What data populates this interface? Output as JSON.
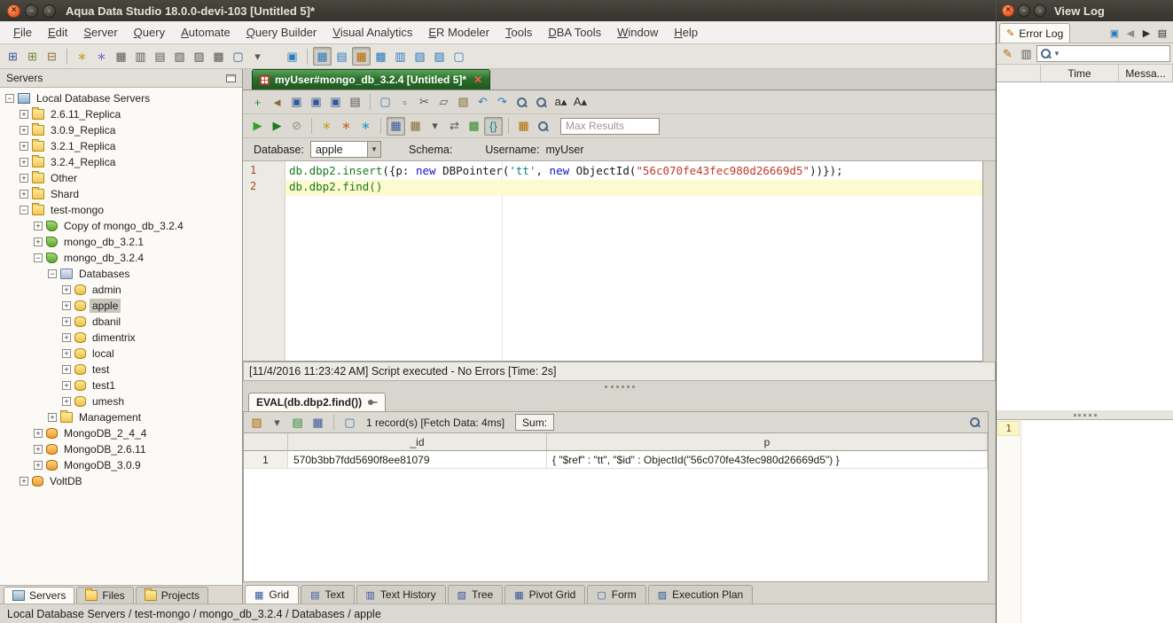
{
  "window": {
    "title": "Aqua Data Studio 18.0.0-devi-103 [Untitled 5]*"
  },
  "menu": {
    "items": [
      "File",
      "Edit",
      "Server",
      "Query",
      "Automate",
      "Query Builder",
      "Visual Analytics",
      "ER Modeler",
      "Tools",
      "DBA Tools",
      "Window",
      "Help"
    ]
  },
  "main_toolbar": {
    "group1": [
      {
        "name": "register-server-icon",
        "glyph": "⊞",
        "color": "#35589a"
      },
      {
        "name": "discover-servers-icon",
        "glyph": "⊞",
        "color": "#6a8a35"
      },
      {
        "name": "connection-manager-icon",
        "glyph": "⊟",
        "color": "#8a6d3b"
      },
      {
        "sep": true
      },
      {
        "name": "schema-compare-wand-icon",
        "glyph": "∗",
        "color": "#c9a227"
      },
      {
        "name": "script-wand-icon",
        "glyph": "∗",
        "color": "#8a6dc9"
      },
      {
        "name": "find-tables-icon",
        "glyph": "▦",
        "color": "#5a5750"
      },
      {
        "name": "find-views-icon",
        "glyph": "▥",
        "color": "#5a5750"
      },
      {
        "name": "find-procedures-icon",
        "glyph": "▤",
        "color": "#5a5750"
      },
      {
        "name": "find-columns-icon",
        "glyph": "▧",
        "color": "#5a5750"
      },
      {
        "name": "find-indexes-icon",
        "glyph": "▨",
        "color": "#5a5750"
      },
      {
        "name": "find-scripts-icon",
        "glyph": "▩",
        "color": "#5a5750"
      },
      {
        "name": "open-document-icon",
        "glyph": "▢",
        "color": "#35589a"
      },
      {
        "name": "open-document-dropdown-icon",
        "glyph": "▾",
        "color": "#5a5750"
      }
    ],
    "group2": [
      {
        "name": "query-analyzer-icon",
        "glyph": "▣",
        "color": "#2b7bbd"
      },
      {
        "sep": true
      },
      {
        "name": "results-grid-mode-icon",
        "glyph": "▦",
        "color": "#2b7bbd",
        "pressed": true
      },
      {
        "name": "results-text-mode-icon",
        "glyph": "▤",
        "color": "#2b7bbd"
      },
      {
        "name": "pin-results-icon",
        "glyph": "▦",
        "color": "#b26a00",
        "pressed": true
      },
      {
        "name": "multi-grid-icon",
        "glyph": "▩",
        "color": "#2b7bbd"
      },
      {
        "name": "history-grid-icon",
        "glyph": "▥",
        "color": "#2b7bbd"
      },
      {
        "name": "tree-window-icon",
        "glyph": "▧",
        "color": "#2b7bbd"
      },
      {
        "name": "pivot-window-icon",
        "glyph": "▨",
        "color": "#2b7bbd"
      },
      {
        "name": "form-window-icon",
        "glyph": "▢",
        "color": "#2b7bbd"
      }
    ]
  },
  "servers_panel": {
    "title": "Servers",
    "tree": [
      {
        "label": "Local Database Servers",
        "level": 0,
        "toggle": "minus",
        "icon": "computer"
      },
      {
        "label": "2.6.11_Replica",
        "level": 1,
        "toggle": "plus",
        "icon": "folder"
      },
      {
        "label": "3.0.9_Replica",
        "level": 1,
        "toggle": "plus",
        "icon": "folder"
      },
      {
        "label": "3.2.1_Replica",
        "level": 1,
        "toggle": "plus",
        "icon": "folder"
      },
      {
        "label": "3.2.4_Replica",
        "level": 1,
        "toggle": "plus",
        "icon": "folder"
      },
      {
        "label": "Other",
        "level": 1,
        "toggle": "plus",
        "icon": "folder"
      },
      {
        "label": "Shard",
        "level": 1,
        "toggle": "plus",
        "icon": "folder"
      },
      {
        "label": "test-mongo",
        "level": 1,
        "toggle": "minus",
        "icon": "folder"
      },
      {
        "label": "Copy of mongo_db_3.2.4",
        "level": 2,
        "toggle": "plus",
        "icon": "mongo"
      },
      {
        "label": "mongo_db_3.2.1",
        "level": 2,
        "toggle": "plus",
        "icon": "mongo"
      },
      {
        "label": "mongo_db_3.2.4",
        "level": 2,
        "toggle": "minus",
        "icon": "mongo"
      },
      {
        "label": "Databases",
        "level": 3,
        "toggle": "minus",
        "icon": "dbfolder"
      },
      {
        "label": "admin",
        "level": 4,
        "toggle": "plus",
        "icon": "db"
      },
      {
        "label": "apple",
        "level": 4,
        "toggle": "plus",
        "icon": "db",
        "selected": true
      },
      {
        "label": "dbanil",
        "level": 4,
        "toggle": "plus",
        "icon": "db"
      },
      {
        "label": "dimentrix",
        "level": 4,
        "toggle": "plus",
        "icon": "db"
      },
      {
        "label": "local",
        "level": 4,
        "toggle": "plus",
        "icon": "db"
      },
      {
        "label": "test",
        "level": 4,
        "toggle": "plus",
        "icon": "db"
      },
      {
        "label": "test1",
        "level": 4,
        "toggle": "plus",
        "icon": "db"
      },
      {
        "label": "umesh",
        "level": 4,
        "toggle": "plus",
        "icon": "db"
      },
      {
        "label": "Management",
        "level": 3,
        "toggle": "plus",
        "icon": "folder"
      },
      {
        "label": "MongoDB_2_4_4",
        "level": 2,
        "toggle": "plus",
        "icon": "dbserver"
      },
      {
        "label": "MongoDB_2.6.11",
        "level": 2,
        "toggle": "plus",
        "icon": "dbserver"
      },
      {
        "label": "MongoDB_3.0.9",
        "level": 2,
        "toggle": "plus",
        "icon": "dbserver"
      },
      {
        "label": "VoltDB",
        "level": 1,
        "toggle": "plus",
        "icon": "dbserver"
      }
    ],
    "tabs": [
      {
        "label": "Servers",
        "icon": "computer",
        "active": true
      },
      {
        "label": "Files",
        "icon": "folder",
        "active": false
      },
      {
        "label": "Projects",
        "icon": "folder",
        "active": false
      }
    ]
  },
  "document": {
    "tab_label": "myUser#mongo_db_3.2.4 [Untitled 5]*",
    "max_results_placeholder": "Max Results",
    "toolbar_row1": [
      {
        "name": "new-file-icon",
        "glyph": "+",
        "color": "#2e8b2e"
      },
      {
        "name": "open-file-icon",
        "glyph": "◄",
        "color": "#8a6d3b"
      },
      {
        "name": "save-file-icon",
        "glyph": "▣",
        "color": "#35589a"
      },
      {
        "name": "save-all-icon",
        "glyph": "▣",
        "color": "#35589a"
      },
      {
        "name": "save-as-icon",
        "glyph": "▣",
        "color": "#35589a"
      },
      {
        "name": "print-icon",
        "glyph": "▤",
        "color": "#5a5750"
      },
      {
        "sep": true
      },
      {
        "name": "describe-object-icon",
        "glyph": "▢",
        "color": "#2b7bbd"
      },
      {
        "name": "select-block-icon",
        "glyph": "▫",
        "color": "#5a5750"
      },
      {
        "name": "cut-icon",
        "glyph": "✂",
        "color": "#5a5750"
      },
      {
        "name": "copy-icon",
        "glyph": "▱",
        "color": "#5a5750"
      },
      {
        "name": "paste-icon",
        "glyph": "▨",
        "color": "#8a6d3b"
      },
      {
        "name": "undo-icon",
        "glyph": "↶",
        "color": "#2b7bbd"
      },
      {
        "name": "redo-icon",
        "glyph": "↷",
        "color": "#2b7bbd"
      },
      {
        "name": "find-icon",
        "glyph": "mag"
      },
      {
        "name": "find-next-icon",
        "glyph": "mag"
      },
      {
        "name": "font-decrease-icon",
        "glyph": "a▴",
        "color": "#2f2d29"
      },
      {
        "name": "font-increase-icon",
        "glyph": "A▴",
        "color": "#2f2d29"
      }
    ],
    "toolbar_row2": [
      {
        "name": "execute-icon",
        "glyph": "▶",
        "color": "#2fa12f"
      },
      {
        "name": "execute-edit-icon",
        "glyph": "▶",
        "color": "#217821"
      },
      {
        "name": "cancel-execution-icon",
        "glyph": "⊘",
        "color": "#8f8c84"
      },
      {
        "sep": true
      },
      {
        "name": "format-sql-wand-icon",
        "glyph": "∗",
        "color": "#c9a227"
      },
      {
        "name": "convert-case-wand-icon",
        "glyph": "∗",
        "color": "#c96a27"
      },
      {
        "name": "snippet-wand-icon",
        "glyph": "∗",
        "color": "#27a0c9"
      },
      {
        "sep": true
      },
      {
        "name": "grid-results-icon",
        "glyph": "▦",
        "color": "#35589a",
        "pressed": true
      },
      {
        "name": "edit-grid-icon",
        "glyph": "▦",
        "color": "#8a6d3b"
      },
      {
        "name": "grid-options-dropdown-icon",
        "glyph": "▾",
        "color": "#5a5750"
      },
      {
        "name": "swap-results-icon",
        "glyph": "⇄",
        "color": "#5a5750"
      },
      {
        "name": "excel-grid-icon",
        "glyph": "▩",
        "color": "#2e8b2e"
      },
      {
        "name": "json-format-icon",
        "glyph": "{}",
        "color": "#0f7f7f",
        "pressed": true
      },
      {
        "sep": true
      },
      {
        "name": "pin-grid-icon",
        "glyph": "▦",
        "color": "#b26a00"
      },
      {
        "name": "grid-search-icon",
        "glyph": "mag"
      }
    ],
    "context": {
      "database_label": "Database:",
      "database_value": "apple",
      "schema_label": "Schema:",
      "username_label": "Username:",
      "username_value": "myUser"
    },
    "editor": {
      "lines": [
        {
          "num": "1",
          "current": false,
          "segments": [
            {
              "text": "db.dbp2.insert",
              "color": "#1a7a1a"
            },
            {
              "text": "({p: ",
              "color": "#1c1c1c"
            },
            {
              "text": "new",
              "color": "#1414cc"
            },
            {
              "text": " DBPointer(",
              "color": "#1c1c1c"
            },
            {
              "text": "'tt'",
              "color": "#0f7f7f"
            },
            {
              "text": ", ",
              "color": "#1c1c1c"
            },
            {
              "text": "new",
              "color": "#1414cc"
            },
            {
              "text": " ObjectId(",
              "color": "#1c1c1c"
            },
            {
              "text": "\"56c070fe43fec980d26669d5\"",
              "color": "#c0392b"
            },
            {
              "text": "))});",
              "color": "#1c1c1c"
            }
          ]
        },
        {
          "num": "2",
          "current": true,
          "segments": [
            {
              "text": "db.dbp2.find()",
              "color": "#1a7a1a"
            }
          ]
        }
      ]
    },
    "execution_message": "[11/4/2016 11:23:42 AM] Script executed - No Errors [Time: 2s]"
  },
  "results": {
    "tab_label": "EVAL(db.dbp2.find())",
    "toolbar_icons": [
      {
        "name": "visual-analytics-icon",
        "glyph": "▧",
        "color": "#b26a00"
      },
      {
        "name": "chart-dropdown-icon",
        "glyph": "▾",
        "color": "#5a5750"
      },
      {
        "name": "export-grid-icon",
        "glyph": "▤",
        "color": "#2e8b2e"
      },
      {
        "name": "save-grid-icon",
        "glyph": "▦",
        "color": "#35589a"
      },
      {
        "sep": true
      },
      {
        "name": "script-grid-icon",
        "glyph": "▢",
        "color": "#2b7bbd"
      }
    ],
    "record_info": "1 record(s) [Fetch Data: 4ms]",
    "sum_label": "Sum:",
    "grid": {
      "columns": [
        "_id",
        "p"
      ],
      "rows": [
        {
          "num": "1",
          "cells": [
            "570b3bb7fdd5690f8ee81079",
            "{ \"$ref\" : \"tt\", \"$id\" : ObjectId(\"56c070fe43fec980d26669d5\") }"
          ]
        }
      ]
    },
    "tabs": [
      {
        "label": "Grid",
        "glyph": "▦",
        "active": true
      },
      {
        "label": "Text",
        "glyph": "▤",
        "active": false
      },
      {
        "label": "Text History",
        "glyph": "▥",
        "active": false
      },
      {
        "label": "Tree",
        "glyph": "▧",
        "active": false
      },
      {
        "label": "Pivot Grid",
        "glyph": "▦",
        "active": false
      },
      {
        "label": "Form",
        "glyph": "▢",
        "active": false
      },
      {
        "label": "Execution Plan",
        "glyph": "▨",
        "active": false
      }
    ]
  },
  "status_bar": {
    "path": "Local Database Servers / test-mongo / mongo_db_3.2.4 / Databases / apple"
  },
  "view_log": {
    "title": "View Log",
    "tab_label": "Error Log",
    "tab_icons": [
      {
        "name": "viewlog-window-icon",
        "glyph": "▣",
        "color": "#2b7bbd"
      },
      {
        "name": "previous-log-icon",
        "glyph": "◀",
        "color": "#8f8c84"
      },
      {
        "name": "next-log-icon",
        "glyph": "▶",
        "color": "#2f2d29"
      },
      {
        "name": "log-options-icon",
        "glyph": "▤",
        "color": "#2f2d29"
      }
    ],
    "toolbar_icons": [
      {
        "name": "clear-log-icon",
        "glyph": "✎",
        "color": "#b26a00"
      },
      {
        "name": "copy-log-icon",
        "glyph": "▥",
        "color": "#5a5750"
      }
    ],
    "columns": [
      "",
      "Time",
      "Messa..."
    ],
    "gutter_line": "1"
  }
}
